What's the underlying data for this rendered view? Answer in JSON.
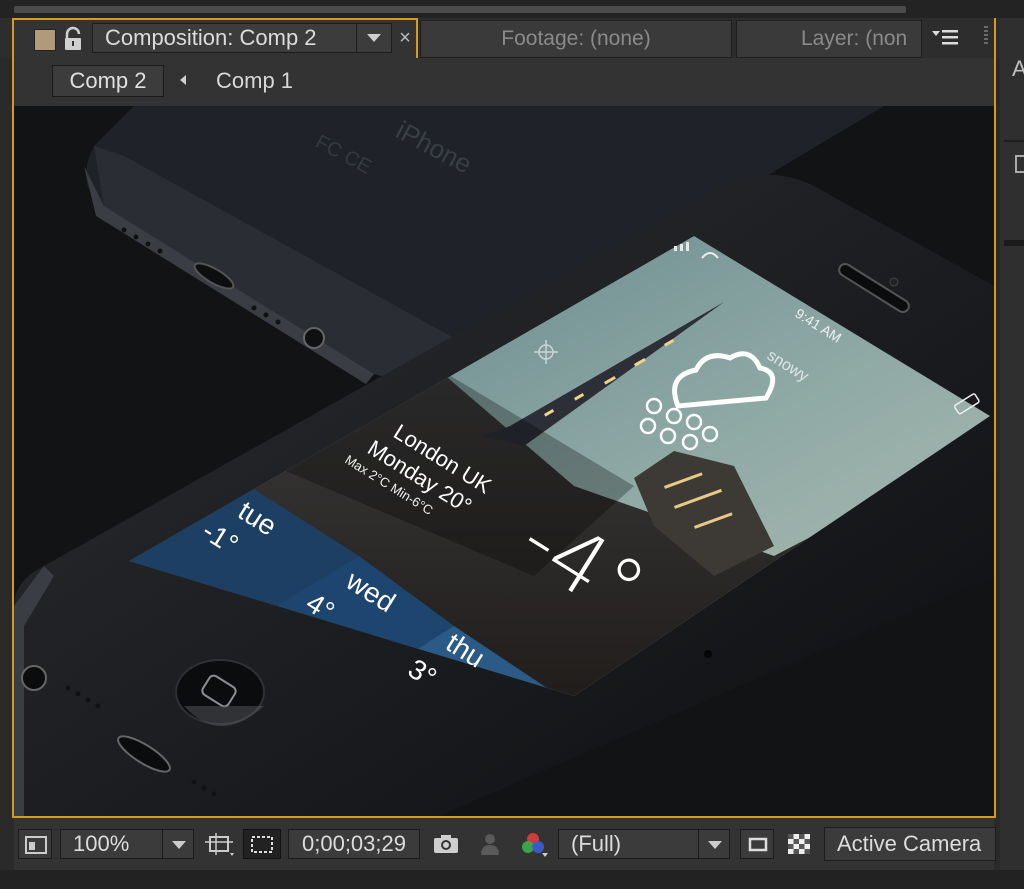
{
  "panel": {
    "composition_tab": "Composition: Comp 2",
    "close_glyph": "×",
    "footage_tab": "Footage: (none)",
    "layer_tab": "Layer: (non"
  },
  "breadcrumb": {
    "current": "Comp 2",
    "parent": "Comp 1"
  },
  "right_panel": {
    "letter": "A"
  },
  "viewer": {
    "phone_back_text": "iPhone",
    "status_time": "9:41 AM",
    "weather": {
      "condition": "snowy",
      "city": "London UK",
      "day_temp": "Monday 20°",
      "max_min": "Max 2°C Min-6°C",
      "current_temp": "-4°",
      "forecast": [
        {
          "day": "tue",
          "temp": "-1°"
        },
        {
          "day": "wed",
          "temp": "4°"
        },
        {
          "day": "thu",
          "temp": "3°"
        }
      ]
    }
  },
  "toolbar": {
    "zoom": "100%",
    "timecode": "0;00;03;29",
    "resolution": "(Full)",
    "camera": "Active Camera"
  },
  "colors": {
    "accent": "#d69a1f",
    "forecast_tue": "#1c3f63",
    "forecast_wed": "#1e4570",
    "forecast_thu": "#2b5a87"
  },
  "icons": [
    "lock-icon",
    "dropdown-arrow-icon",
    "panel-menu-icon",
    "camera-icon",
    "person-icon",
    "channel-icon",
    "grid-icon",
    "mask-icon",
    "cloud-icon",
    "crosshair-icon"
  ]
}
